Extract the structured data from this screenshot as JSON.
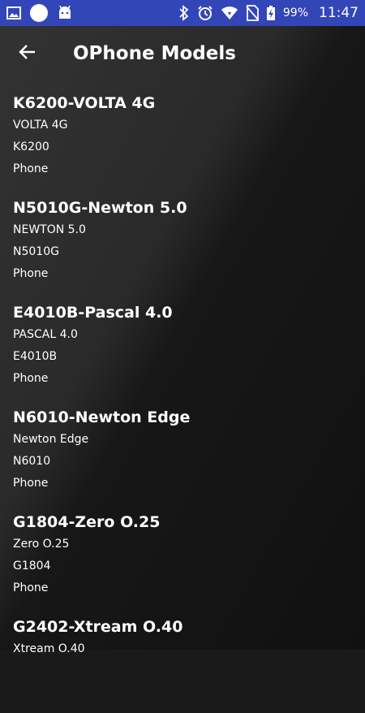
{
  "status_bar": {
    "battery_percent": "99%",
    "time": "11:47",
    "icons": [
      "image-icon",
      "circle-icon",
      "android-icon",
      "bluetooth-icon",
      "alarm-icon",
      "wifi-icon",
      "no-sim-icon",
      "battery-charging-icon"
    ]
  },
  "app_bar": {
    "title": "OPhone Models",
    "back_icon": "arrow-back-icon"
  },
  "models": [
    {
      "title": "K6200-VOLTA 4G",
      "name": "VOLTA 4G",
      "code": "K6200",
      "type": "Phone"
    },
    {
      "title": "N5010G-Newton 5.0",
      "name": "NEWTON 5.0",
      "code": "N5010G",
      "type": "Phone"
    },
    {
      "title": "E4010B-Pascal 4.0",
      "name": "PASCAL 4.0",
      "code": "E4010B",
      "type": "Phone"
    },
    {
      "title": "N6010-Newton Edge",
      "name": "Newton Edge",
      "code": "N6010",
      "type": "Phone"
    },
    {
      "title": "G1804-Zero O.25",
      "name": "Zero O.25",
      "code": "G1804",
      "type": "Phone"
    },
    {
      "title": "G2402-Xtream O.40",
      "name": "Xtream O.40",
      "code": "",
      "type": ""
    }
  ],
  "colors": {
    "status_bar": "#3346b8",
    "background_light": "#333333",
    "background_dark": "#111111",
    "text": "#ffffff"
  }
}
